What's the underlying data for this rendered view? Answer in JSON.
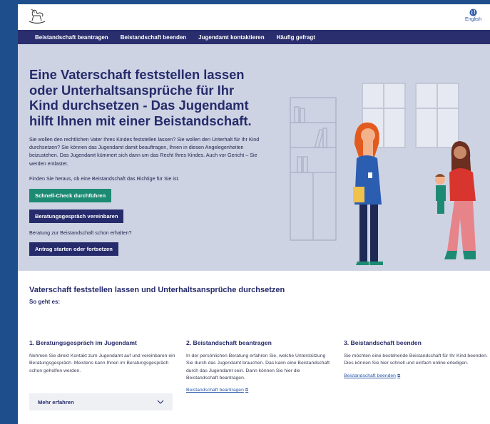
{
  "header": {
    "logo_icon": "rocking-horse-icon",
    "language_label": "English",
    "language_icon": "globe-icon"
  },
  "nav": {
    "items": [
      {
        "label": "Beistandschaft beantragen"
      },
      {
        "label": "Beistandschaft beenden"
      },
      {
        "label": "Jugendamt kontaktieren"
      },
      {
        "label": "Häufig gefragt"
      }
    ]
  },
  "hero": {
    "title": "Eine Vaterschaft feststellen lassen oder Unterhaltsansprüche für Ihr Kind durchsetzen - Das Jugendamt hilft Ihnen mit einer Beistandschaft.",
    "intro": "Sie wollen den rechtlichen Vater Ihres Kindes feststellen lassen? Sie wollen den Unterhalt für Ihr Kind durchsetzen? Sie können das Jugendamt damit beauftragen, Ihnen in diesen Angelegenheiten beizustehen. Das Jugendamt kümmert sich dann um das Recht Ihres Kindes. Auch vor Gericht – Sie werden entlastet.",
    "finden": "Finden Sie heraus, ob eine Beistandschaft das Richtige für Sie ist.",
    "btn_check": "Schnell-Check durchführen",
    "btn_beratung": "Beratungsgespräch vereinbaren",
    "beratung_text": "Beratung zur Beistandschaft schon erhalten?",
    "btn_antrag": "Antrag starten oder fortsetzen"
  },
  "section": {
    "title": "Vaterschaft feststellen lassen und Unterhaltsansprüche durchsetzen",
    "subtitle": "So geht es:",
    "steps": [
      {
        "title": "1. Beratungsgespräch im Jugendamt",
        "text": "Nehmen Sie direkt Kontakt zum Jugendamt auf und vereinbaren ein Beratungsgespräch. Meistens kann Ihnen im Beratungsgespräch schon geholfen werden.",
        "accordion": "Mehr erfahren"
      },
      {
        "title": "2. Beistandschaft beantragen",
        "text": "In der persönlichen Beratung erfahren Sie, welche Unterstützung Sie durch das Jugendamt brauchen.  Das kann eine Beistandschaft durch das Jugendamt sein. Dann können Sie hier die Beistandschaft beantragen.",
        "link": "Beistandschaft beantragen"
      },
      {
        "title": "3. Beistandschaft beenden",
        "text": "Sie möchten eine bestehende Beistandschaft für Ihr Kind beenden. Dies können Sie hier schnell und einfach online erledigen.",
        "link": "Beistandschaft beenden"
      }
    ]
  },
  "colors": {
    "outer_bg": "#1e4f8c",
    "nav_bg": "#2a2e6e",
    "hero_bg": "#cdd3e3",
    "primary_text": "#262b6b",
    "accent_green": "#1d8a74",
    "link": "#2c58a8"
  }
}
